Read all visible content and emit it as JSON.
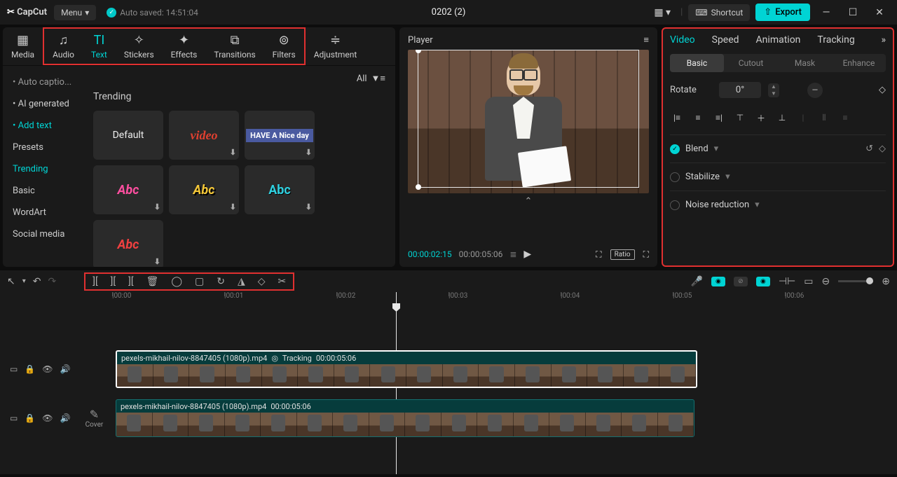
{
  "titlebar": {
    "logo": "CapCut",
    "menu": "Menu",
    "autosave": "Auto saved: 14:51:04",
    "project": "0202 (2)",
    "shortcut": "Shortcut",
    "export": "Export"
  },
  "top_tabs": [
    {
      "label": "Media",
      "icon": "▦"
    },
    {
      "label": "Audio",
      "icon": "♫"
    },
    {
      "label": "Text",
      "icon": "TI",
      "active": true
    },
    {
      "label": "Stickers",
      "icon": "✧"
    },
    {
      "label": "Effects",
      "icon": "✦"
    },
    {
      "label": "Transitions",
      "icon": "⧉"
    },
    {
      "label": "Filters",
      "icon": "⊚"
    },
    {
      "label": "Adjustment",
      "icon": "≑"
    }
  ],
  "sidebar": [
    {
      "label": "Auto captio...",
      "dim": true
    },
    {
      "label": "AI generated"
    },
    {
      "label": "Add text",
      "active": true
    },
    {
      "label": "Presets"
    },
    {
      "label": "Trending",
      "active": true
    },
    {
      "label": "Basic"
    },
    {
      "label": "WordArt"
    },
    {
      "label": "Social media"
    }
  ],
  "content": {
    "all": "All",
    "section": "Trending",
    "thumbs": [
      {
        "text": "Default",
        "style": "color:#eee;font-size:14px;font-weight:normal"
      },
      {
        "text": "video",
        "style": "color:#e04030;font-family:cursive;font-style:italic",
        "dl": true
      },
      {
        "text": "HAVE A\nNice day",
        "style": "color:#fff;font-size:11px;line-height:13px;text-align:center",
        "dl": true,
        "bg": "#4a5aa0"
      },
      {
        "text": "Abc",
        "style": "color:#ff4fa0;font-style:italic",
        "dl": true
      },
      {
        "text": "Abc",
        "style": "color:#f5c838;font-style:italic;text-shadow:2px 2px 0 #000",
        "dl": true
      },
      {
        "text": "Abc",
        "style": "color:#30d0e0;text-shadow:1px 1px 0 #000",
        "dl": true
      },
      {
        "text": "Abc",
        "style": "color:#f04040;font-style:italic",
        "dl": true
      }
    ]
  },
  "player": {
    "title": "Player",
    "current": "00:00:02:15",
    "duration": "00:00:05:06",
    "ratio": "Ratio"
  },
  "right": {
    "tabs": [
      "Video",
      "Speed",
      "Animation",
      "Tracking"
    ],
    "subtabs": [
      "Basic",
      "Cutout",
      "Mask",
      "Enhance"
    ],
    "rotate_label": "Rotate",
    "rotate_val": "0°",
    "blend": "Blend",
    "stabilize": "Stabilize",
    "noise": "Noise reduction"
  },
  "ruler": [
    "|00:00",
    "|00:01",
    "|00:02",
    "|00:03",
    "|00:04",
    "|00:05",
    "|00:06"
  ],
  "tracks": {
    "cover": "Cover",
    "clip1": {
      "name": "pexels-mikhail-nilov-8847405 (1080p).mp4",
      "track": "Tracking",
      "dur": "00:00:05:06"
    },
    "clip2": {
      "name": "pexels-mikhail-nilov-8847405 (1080p).mp4",
      "dur": "00:00:05:06"
    }
  }
}
